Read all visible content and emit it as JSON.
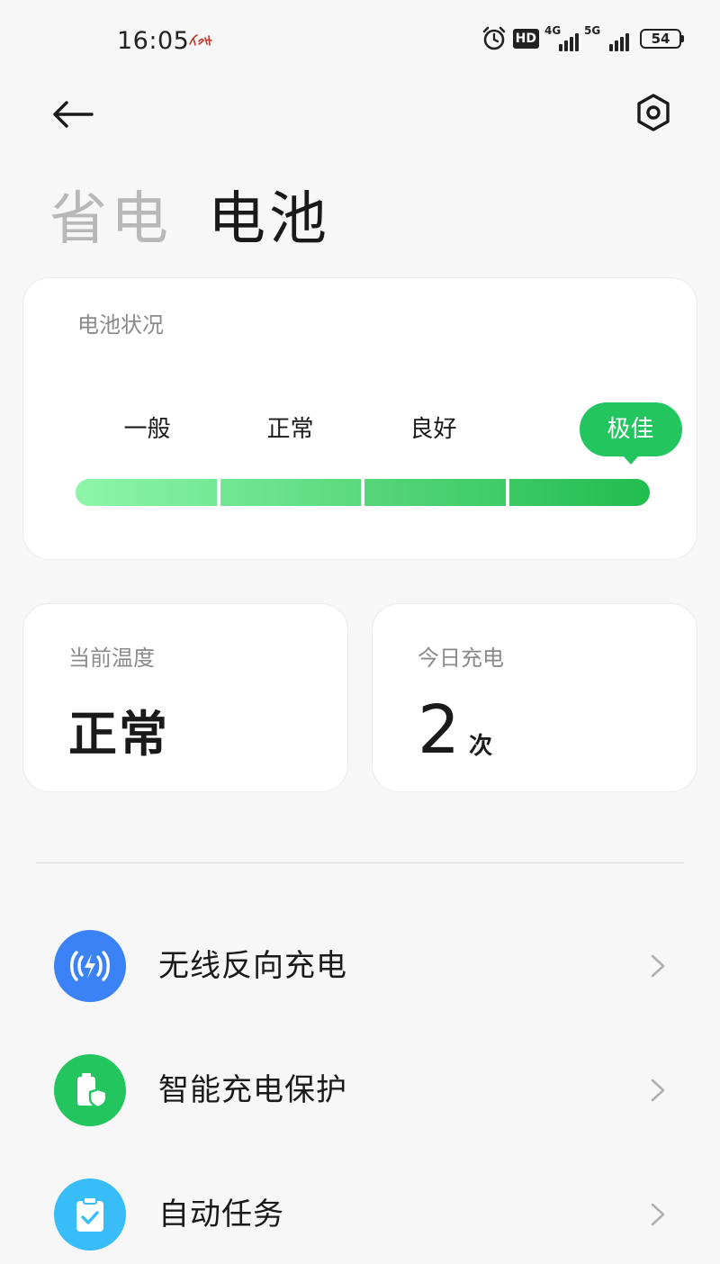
{
  "status_bar": {
    "time": "16:05",
    "hd_badge": "HD",
    "net1_label": "4G",
    "net2_label": "5G",
    "battery_level": "54"
  },
  "tabs": [
    {
      "label": "省电",
      "active": false
    },
    {
      "label": "电池",
      "active": true
    }
  ],
  "battery_health": {
    "title": "电池状况",
    "levels": [
      "一般",
      "正常",
      "良好",
      "极佳"
    ],
    "selected_index": 3
  },
  "temperature": {
    "title": "当前温度",
    "value": "正常"
  },
  "charge_today": {
    "title": "今日充电",
    "count": "2",
    "unit": "次"
  },
  "list": [
    {
      "label": "无线反向充电",
      "icon": "wireless-reverse-charging-icon",
      "color": "#3b82f6"
    },
    {
      "label": "智能充电保护",
      "icon": "smart-charging-protection-icon",
      "color": "#22c55e"
    },
    {
      "label": "自动任务",
      "icon": "auto-task-icon",
      "color": "#38bdf8"
    }
  ],
  "colors": {
    "accent_green": "#22c55e",
    "blue": "#3b82f6",
    "cyan": "#38bdf8"
  }
}
